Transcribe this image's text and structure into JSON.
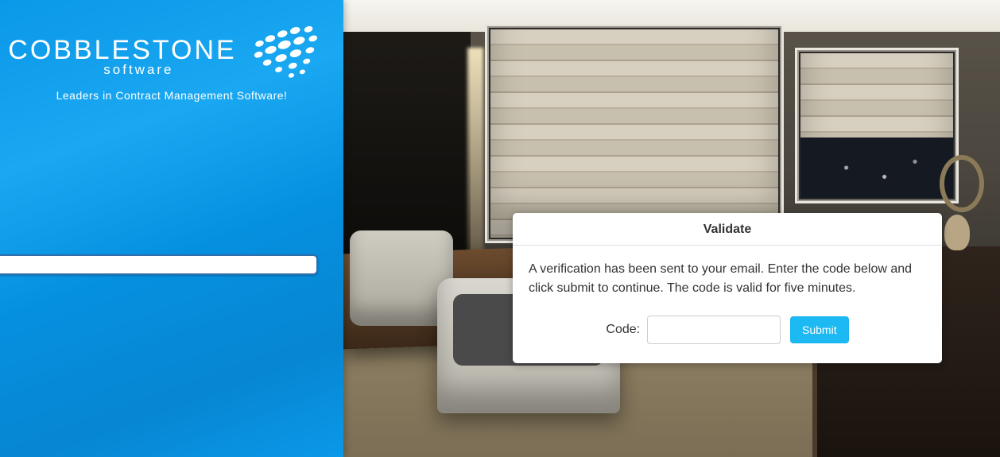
{
  "brand": {
    "name": "COBBLESTONE",
    "sub": "software",
    "tagline": "Leaders in Contract Management Software!"
  },
  "card": {
    "title": "Validate",
    "message": "A verification has been sent to your email. Enter the code below and click submit to continue. The code is valid for five minutes.",
    "code_label": "Code:",
    "code_value": "",
    "submit_label": "Submit"
  }
}
